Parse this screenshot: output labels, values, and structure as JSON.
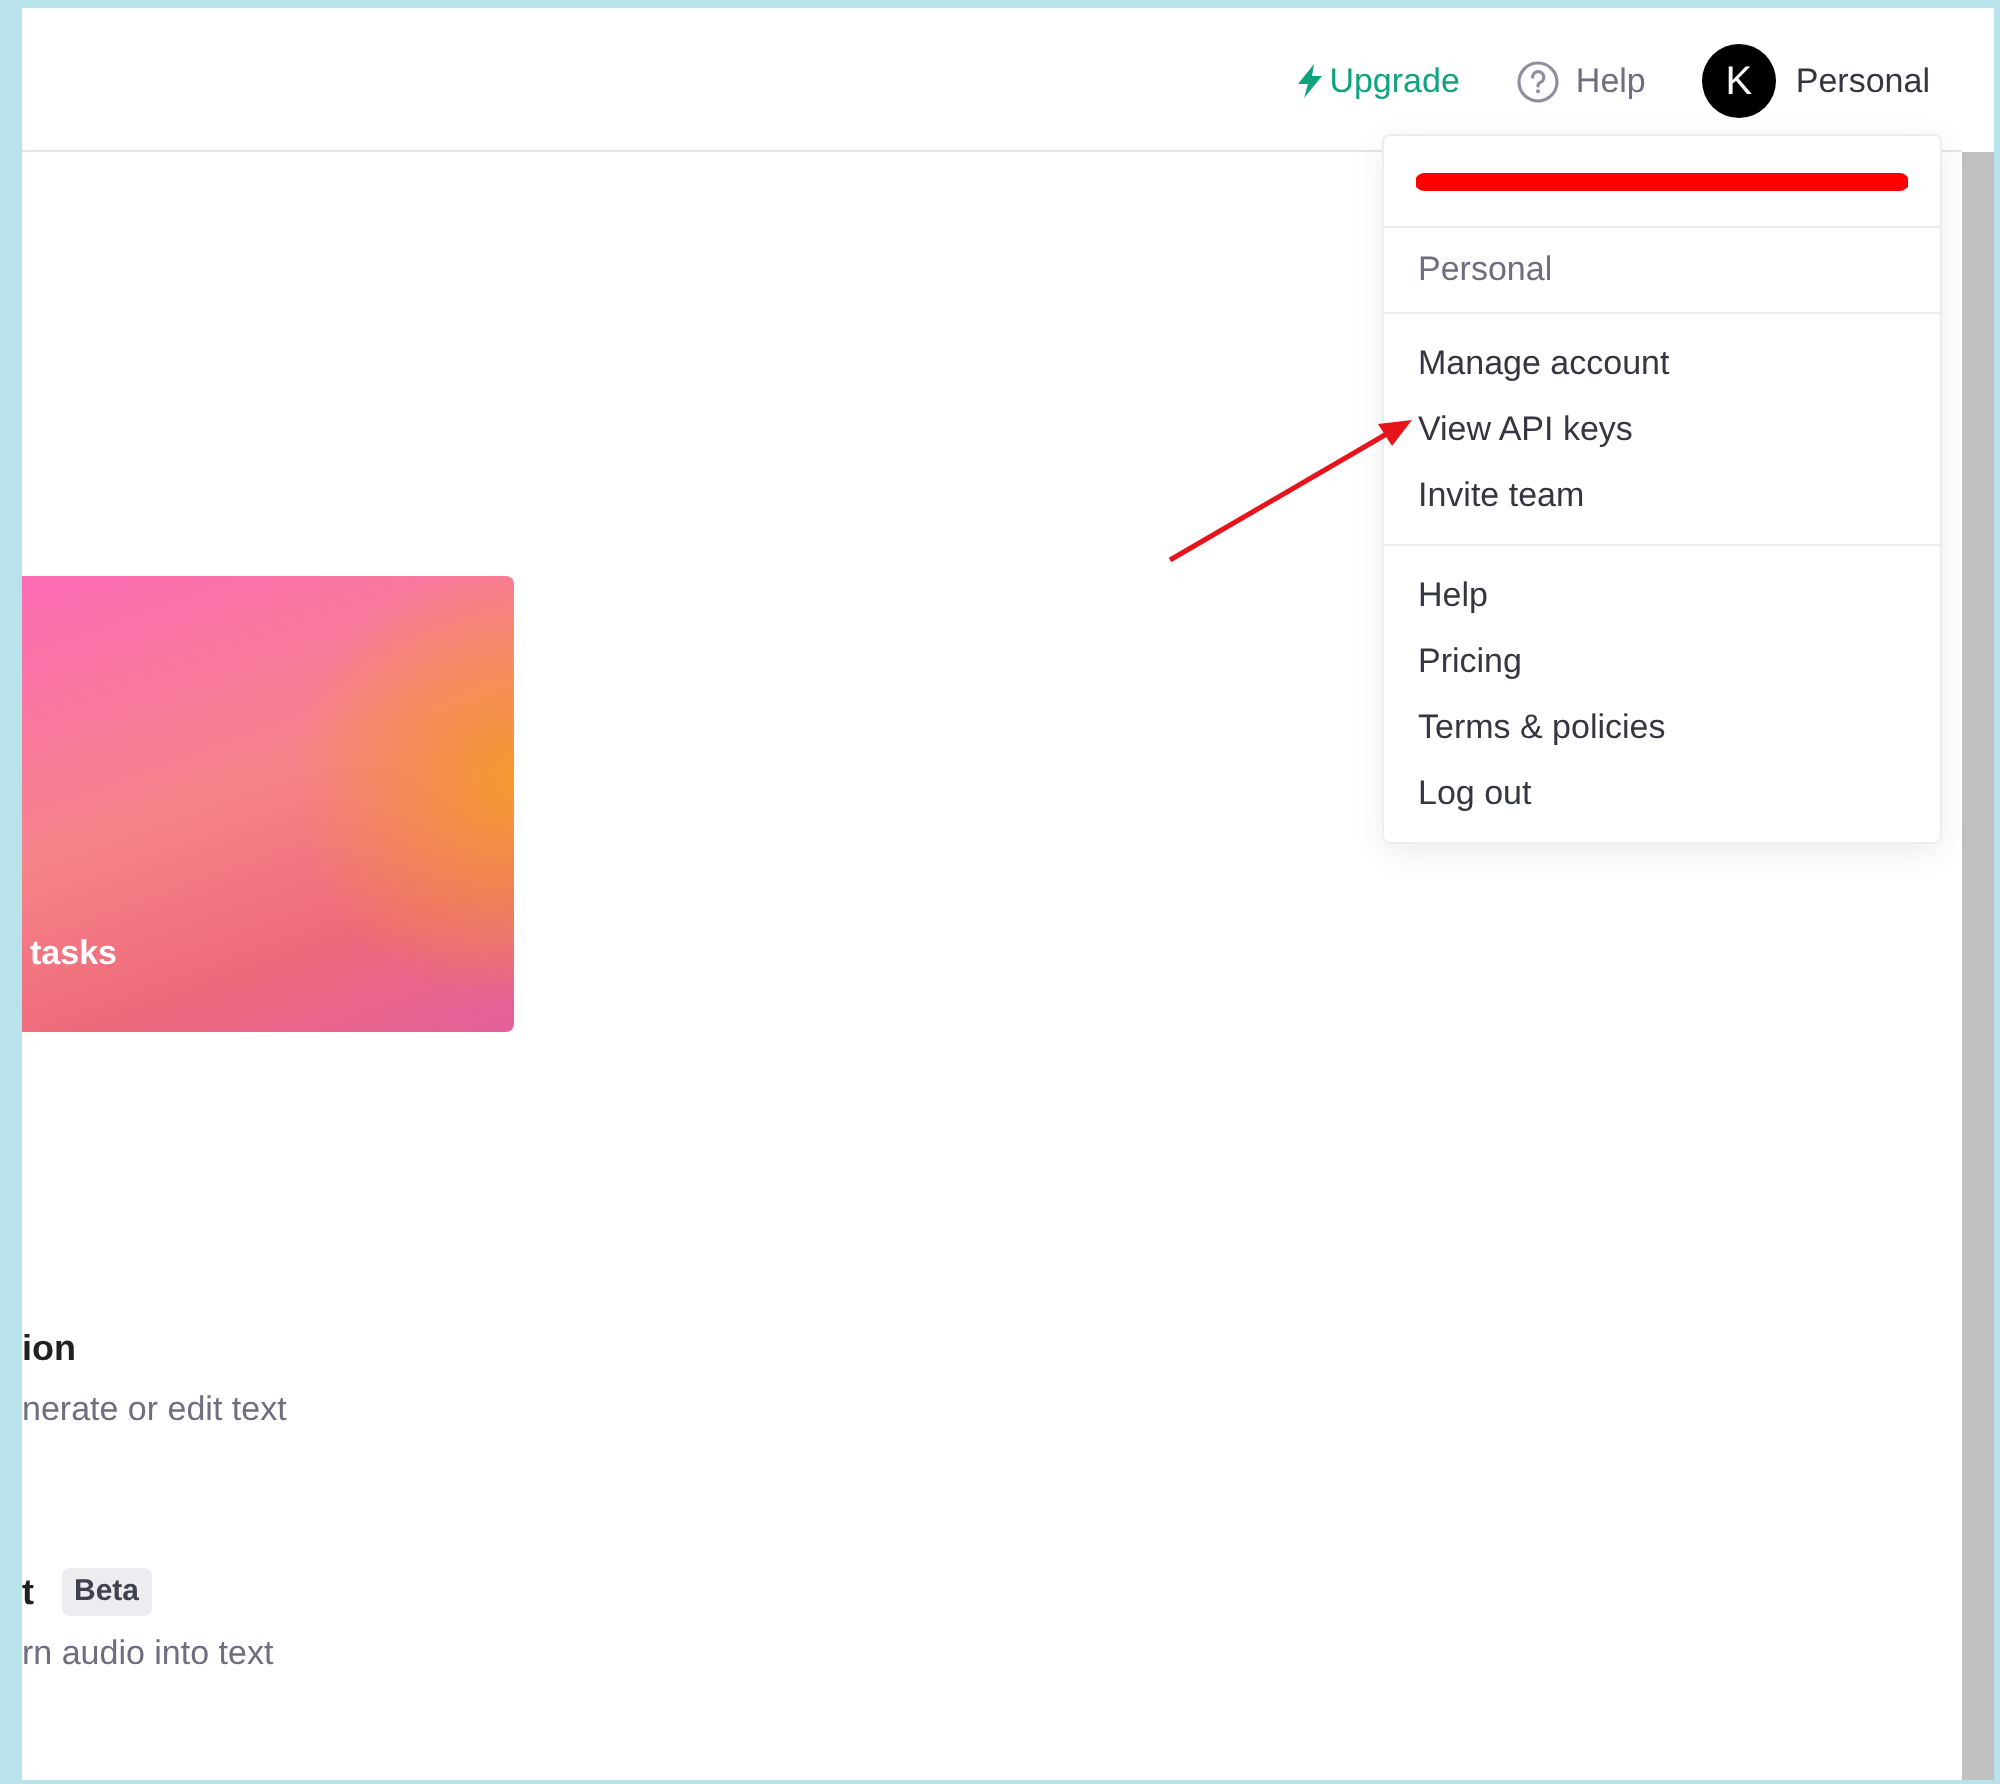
{
  "header": {
    "upgrade": "Upgrade",
    "help": "Help",
    "avatar_initial": "K",
    "account": "Personal"
  },
  "account_menu": {
    "email_redacted": true,
    "groups": [
      {
        "kind": "heading",
        "items": [
          "Personal"
        ]
      },
      {
        "kind": "links",
        "items": [
          "Manage account",
          "View API keys",
          "Invite team"
        ]
      },
      {
        "kind": "links",
        "items": [
          "Help",
          "Pricing",
          "Terms & policies",
          "Log out"
        ]
      }
    ]
  },
  "featured_card": {
    "title": "tasks"
  },
  "models": [
    {
      "title": "ion",
      "description": "nerate or edit text"
    },
    {
      "title": "t",
      "badge": "Beta",
      "description": "rn audio into text"
    }
  ]
}
